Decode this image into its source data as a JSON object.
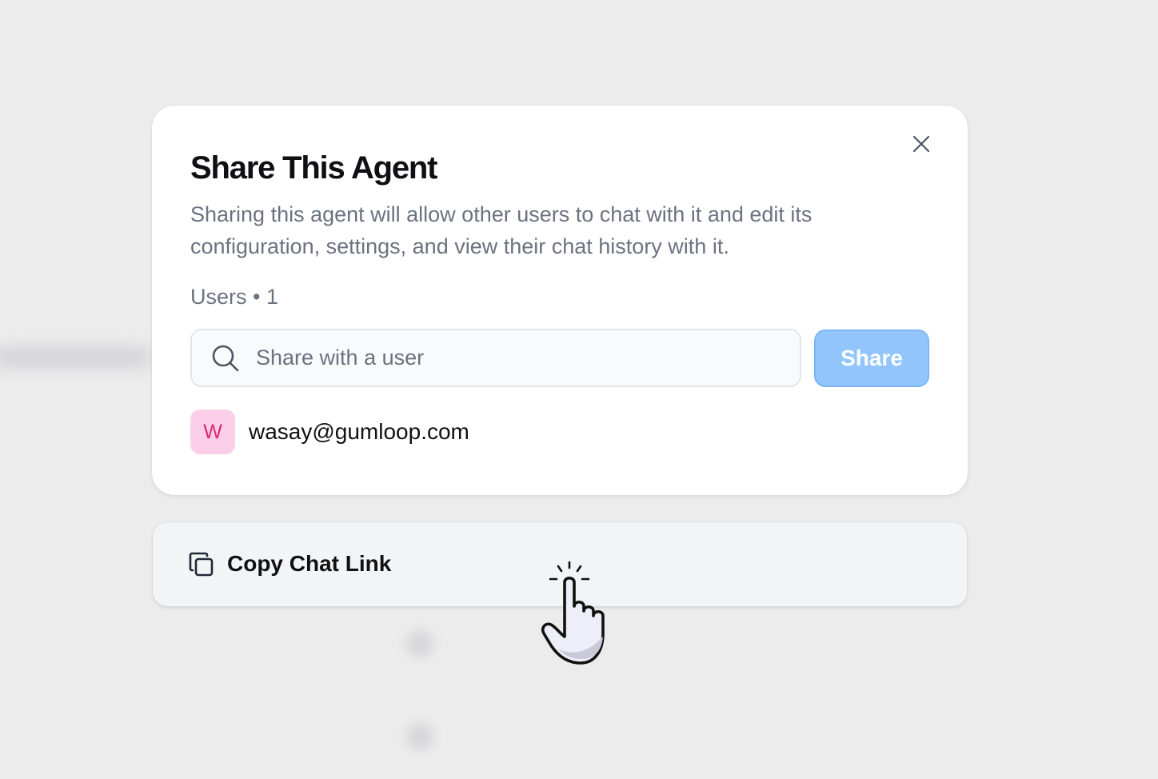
{
  "modal": {
    "title": "Share This Agent",
    "description": "Sharing this agent will allow other users to chat with it and edit its configuration, settings, and view their chat history with it.",
    "users_label": "Users • 1",
    "search": {
      "placeholder": "Share with a user",
      "value": ""
    },
    "share_button_label": "Share",
    "users": [
      {
        "initial": "W",
        "email": "wasay@gumloop.com",
        "avatar_bg": "#fbcfe8",
        "avatar_fg": "#db2777"
      }
    ],
    "icons": {
      "close": "close-icon",
      "search": "search-icon"
    }
  },
  "copy_link": {
    "label": "Copy Chat Link",
    "icon": "copy-icon"
  },
  "colors": {
    "share_button_bg": "#93c5fd",
    "card_bg": "#f3f4f6",
    "backdrop": "#ececed"
  }
}
